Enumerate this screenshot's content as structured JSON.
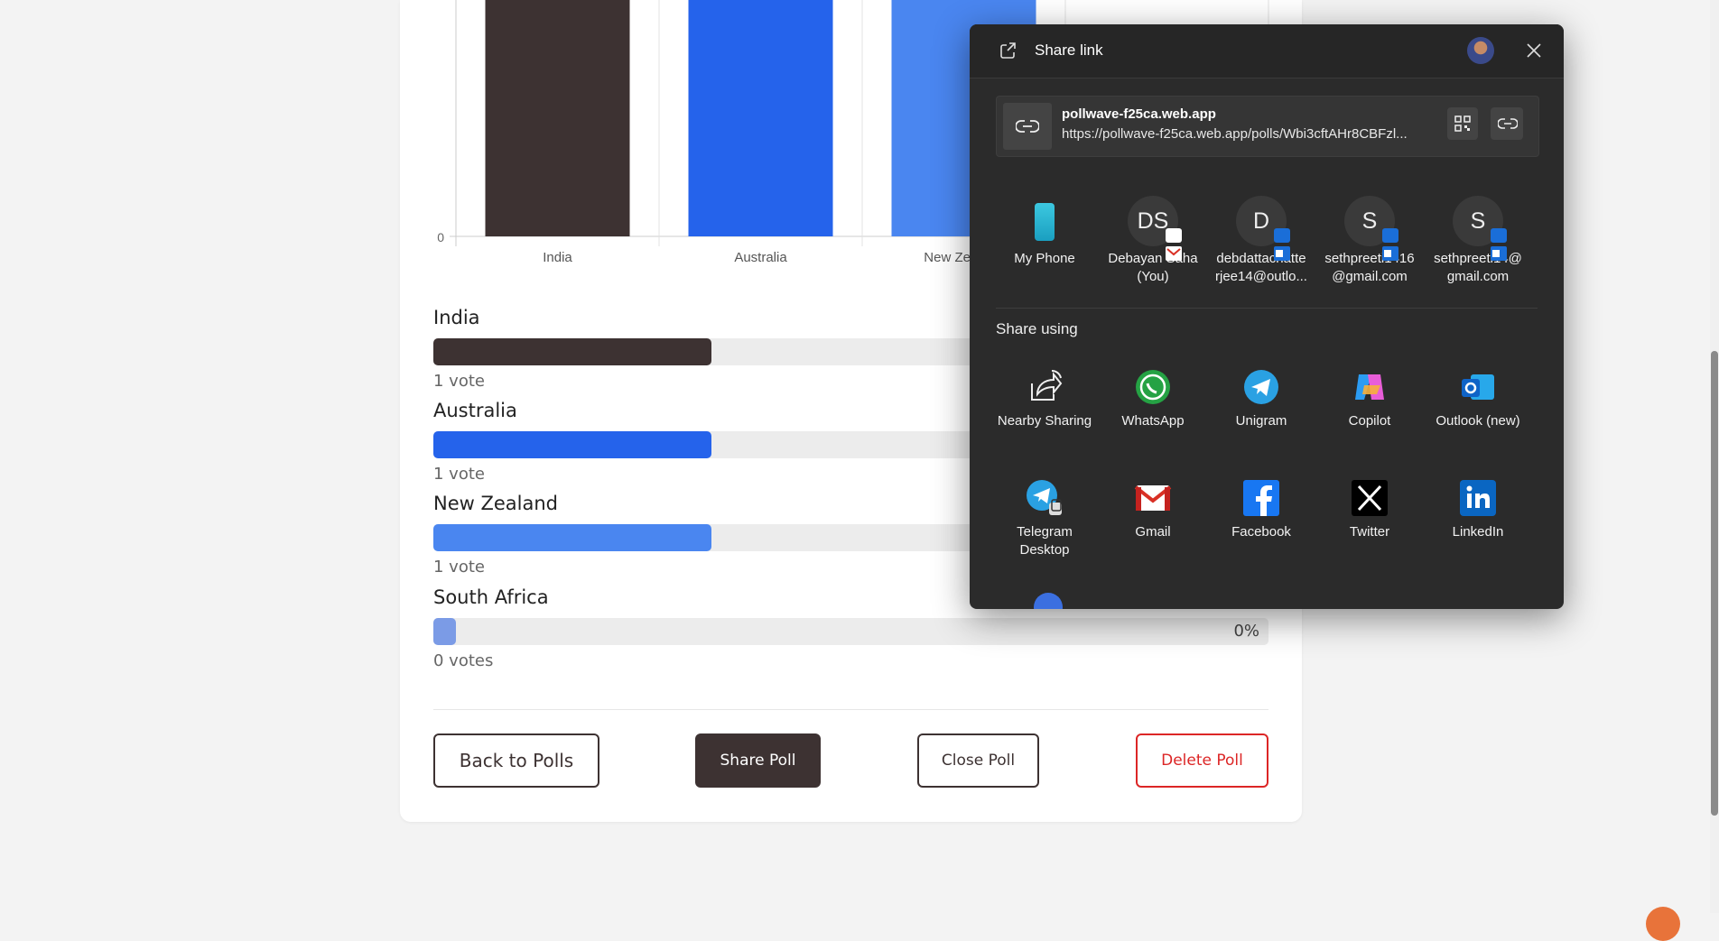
{
  "chart_data": {
    "type": "bar",
    "categories": [
      "India",
      "Australia",
      "New Zealand"
    ],
    "y_tick_visible": "0",
    "colors": [
      "#3d3232",
      "#2563eb",
      "#4a86f0"
    ]
  },
  "results": [
    {
      "label": "India",
      "votes": "1 vote",
      "fraction": 0.333,
      "color": "#3d3232",
      "pct": ""
    },
    {
      "label": "Australia",
      "votes": "1 vote",
      "fraction": 0.333,
      "color": "#2563eb",
      "pct": ""
    },
    {
      "label": "New Zealand",
      "votes": "1 vote",
      "fraction": 0.333,
      "color": "#4a86f0",
      "pct": ""
    },
    {
      "label": "South Africa",
      "votes": "0 votes",
      "fraction": 0.0,
      "color": "#7b9be6",
      "pct": "0%"
    }
  ],
  "actions": {
    "back": "Back to Polls",
    "share": "Share Poll",
    "close": "Close Poll",
    "delete": "Delete Poll"
  },
  "share_dialog": {
    "title": "Share link",
    "link_title": "pollwave-f25ca.web.app",
    "link_url": "https://pollwave-f25ca.web.app/polls/Wbi3cftAHr8CBFzl...",
    "contacts": [
      {
        "initials": "",
        "name_l1": "My Phone",
        "name_l2": "",
        "icon": "phone-icon"
      },
      {
        "initials": "DS",
        "name_l1": "Debayan Saha",
        "name_l2": "(You)",
        "icon": "gmail-badge"
      },
      {
        "initials": "D",
        "name_l1": "debdattachatte",
        "name_l2": "rjee14@outlo...",
        "icon": "outlook-badge"
      },
      {
        "initials": "S",
        "name_l1": "sethpreeti1416",
        "name_l2": "@gmail.com",
        "icon": "outlook-badge"
      },
      {
        "initials": "S",
        "name_l1": "sethpreeti14@",
        "name_l2": "gmail.com",
        "icon": "outlook-badge"
      }
    ],
    "share_using_label": "Share using",
    "apps": [
      {
        "name_l1": "Nearby Sharing",
        "name_l2": "",
        "icon": "nearby-sharing-icon"
      },
      {
        "name_l1": "WhatsApp",
        "name_l2": "",
        "icon": "whatsapp-icon"
      },
      {
        "name_l1": "Unigram",
        "name_l2": "",
        "icon": "unigram-icon"
      },
      {
        "name_l1": "Copilot",
        "name_l2": "",
        "icon": "copilot-icon"
      },
      {
        "name_l1": "Outlook (new)",
        "name_l2": "",
        "icon": "outlook-icon"
      },
      {
        "name_l1": "Telegram",
        "name_l2": "Desktop",
        "icon": "telegram-desktop-icon"
      },
      {
        "name_l1": "Gmail",
        "name_l2": "",
        "icon": "gmail-icon"
      },
      {
        "name_l1": "Facebook",
        "name_l2": "",
        "icon": "facebook-icon"
      },
      {
        "name_l1": "Twitter",
        "name_l2": "",
        "icon": "twitter-icon"
      },
      {
        "name_l1": "LinkedIn",
        "name_l2": "",
        "icon": "linkedin-icon"
      }
    ]
  }
}
